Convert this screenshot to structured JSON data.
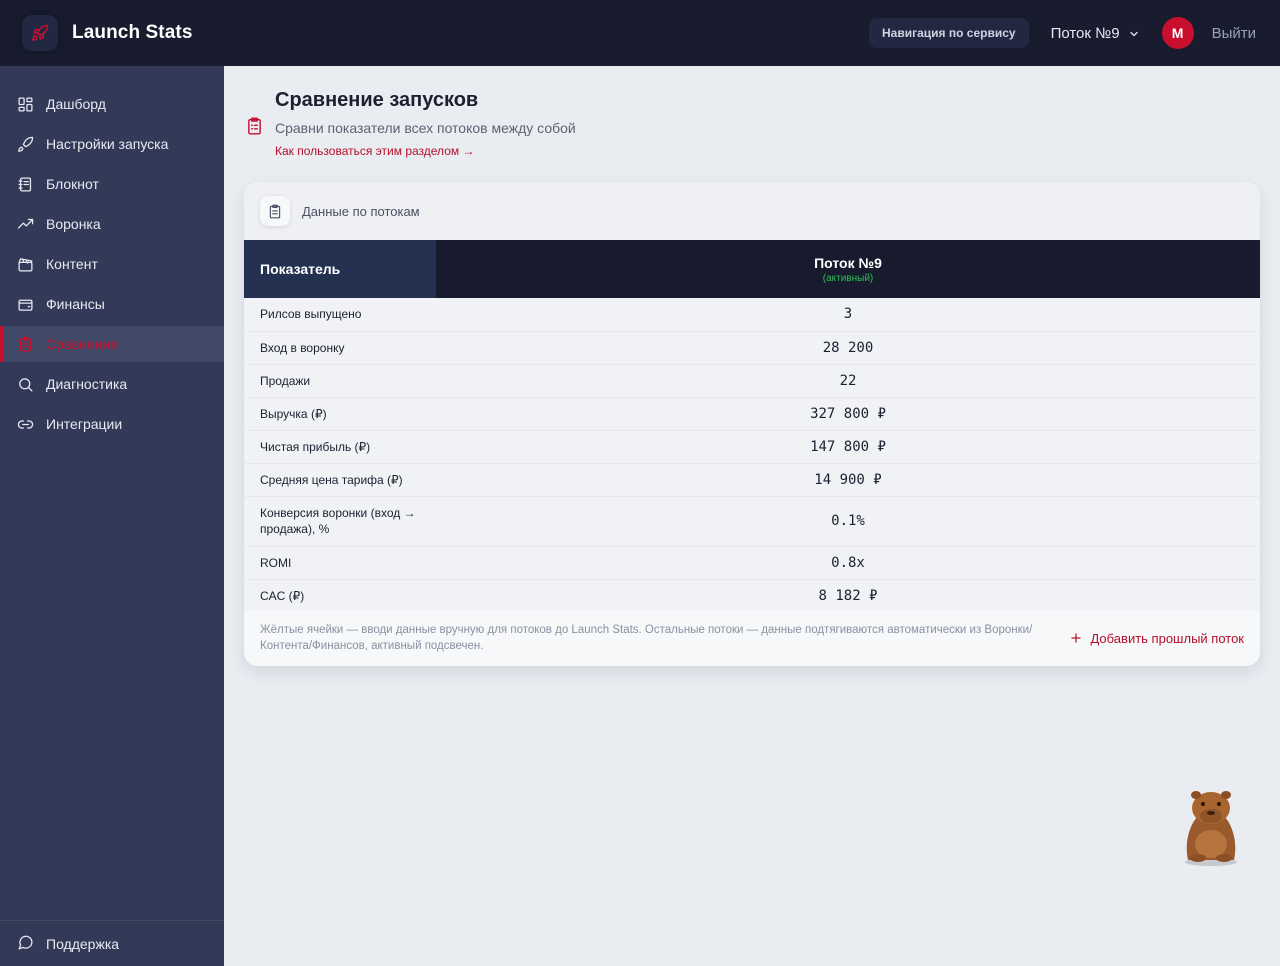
{
  "app": {
    "title": "Launch Stats"
  },
  "header": {
    "nav_button": "Навигация по сервису",
    "stream_select": "Поток №9",
    "avatar_letter": "M",
    "logout": "Выйти"
  },
  "sidebar": {
    "items": [
      {
        "label": "Дашборд",
        "icon": "grid-icon"
      },
      {
        "label": "Настройки запуска",
        "icon": "rocket-icon"
      },
      {
        "label": "Блокнот",
        "icon": "notebook-icon"
      },
      {
        "label": "Воронка",
        "icon": "trending-up-icon"
      },
      {
        "label": "Контент",
        "icon": "clapperboard-icon"
      },
      {
        "label": "Финансы",
        "icon": "wallet-icon"
      },
      {
        "label": "Сравнение",
        "icon": "clipboard-icon",
        "active": true
      },
      {
        "label": "Диагностика",
        "icon": "search-icon"
      },
      {
        "label": "Интеграции",
        "icon": "link-icon"
      }
    ],
    "footer": {
      "label": "Поддержка",
      "icon": "chat-icon"
    }
  },
  "page": {
    "title": "Сравнение запусков",
    "subtitle": "Сравни показатели всех потоков между собой",
    "help_link": "Как пользоваться этим разделом →"
  },
  "card": {
    "title": "Данные по потокам",
    "table": {
      "metric_header": "Показатель",
      "stream_header": "Поток №9",
      "stream_tag": "(активный)",
      "rows": [
        {
          "metric": "Рилсов выпущено",
          "value": "3"
        },
        {
          "metric": "Вход в воронку",
          "value": "28 200"
        },
        {
          "metric": "Продажи",
          "value": "22"
        },
        {
          "metric": "Выручка (₽)",
          "value": "327 800 ₽"
        },
        {
          "metric": "Чистая прибыль (₽)",
          "value": "147 800 ₽"
        },
        {
          "metric": "Средняя цена тарифа (₽)",
          "value": "14 900 ₽"
        },
        {
          "metric": "Конверсия воронки (вход → продажа), %",
          "value": "0.1%"
        },
        {
          "metric": "ROMI",
          "value": "0.8x"
        },
        {
          "metric": "CAC (₽)",
          "value": "8 182 ₽"
        }
      ]
    },
    "footer_note": "Жёлтые ячейки — вводи данные вручную для потоков до Launch Stats. Остальные потоки — данные подтягиваются автоматически из Воронки/Контента/Финансов, активный подсвечен.",
    "add_button": "Добавить прошлый поток"
  },
  "colors": {
    "accent": "#c8102e",
    "topbar": "#181c2e",
    "sidebar": "#333a58",
    "active_tag": "#2fbf5a"
  }
}
